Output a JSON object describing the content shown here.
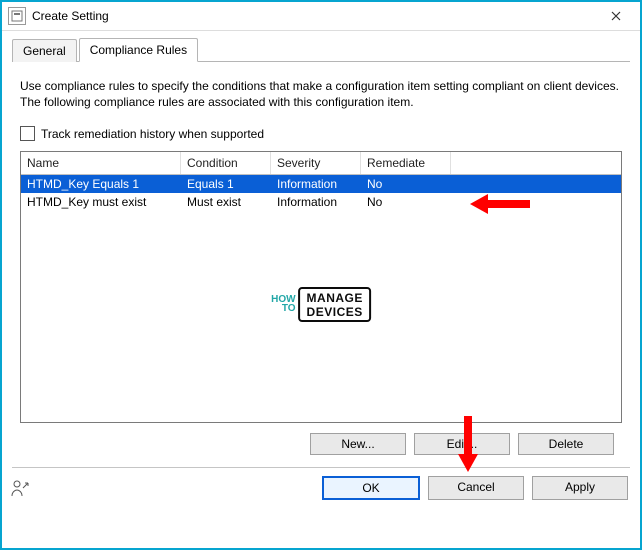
{
  "window": {
    "title": "Create Setting"
  },
  "tabs": [
    {
      "label": "General",
      "active": false
    },
    {
      "label": "Compliance Rules",
      "active": true
    }
  ],
  "description": "Use compliance rules to specify the conditions that make a configuration item setting compliant on client devices. The following compliance rules are associated with this configuration item.",
  "trackCheckbox": {
    "label": "Track remediation history when supported",
    "checked": false
  },
  "grid": {
    "headers": [
      "Name",
      "Condition",
      "Severity",
      "Remediate"
    ],
    "rows": [
      {
        "name": "HTMD_Key Equals 1",
        "condition": "Equals 1",
        "severity": "Information",
        "remediate": "No",
        "selected": true
      },
      {
        "name": "HTMD_Key must exist",
        "condition": "Must exist",
        "severity": "Information",
        "remediate": "No",
        "selected": false
      }
    ]
  },
  "rowButtons": {
    "new": "New...",
    "edit": "Edit...",
    "delete": "Delete"
  },
  "footerButtons": {
    "ok": "OK",
    "cancel": "Cancel",
    "apply": "Apply"
  },
  "watermark": {
    "line1": "HOW",
    "line2": "TO",
    "box1": "MANAGE",
    "box2": "DEVICES"
  }
}
